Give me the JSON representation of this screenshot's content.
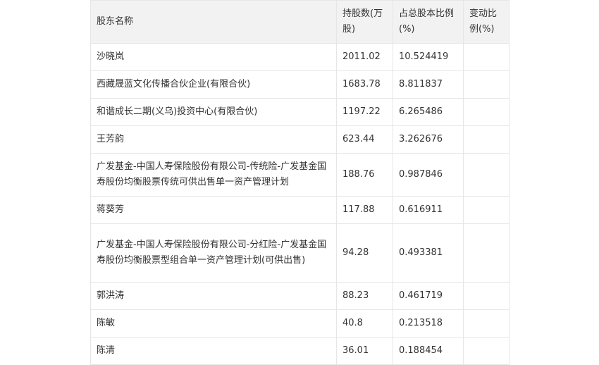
{
  "table": {
    "headers": [
      "股东名称",
      "持股数(万股)",
      "占总股本比例(%)",
      "变动比例(%)"
    ],
    "rows": [
      {
        "name": "沙晓岚",
        "shares": "2011.02",
        "ratio": "10.524419",
        "change": ""
      },
      {
        "name": "西藏晟蓝文化传播合伙企业(有限合伙)",
        "shares": "1683.78",
        "ratio": "8.811837",
        "change": ""
      },
      {
        "name": "和谐成长二期(义乌)投资中心(有限合伙)",
        "shares": "1197.22",
        "ratio": "6.265486",
        "change": ""
      },
      {
        "name": "王芳韵",
        "shares": "623.44",
        "ratio": "3.262676",
        "change": ""
      },
      {
        "name": "广发基金-中国人寿保险股份有限公司-传统险-广发基金国寿股份均衡股票传统可供出售单一资产管理计划",
        "shares": "188.76",
        "ratio": "0.987846",
        "change": ""
      },
      {
        "name": "蒋葵芳",
        "shares": "117.88",
        "ratio": "0.616911",
        "change": ""
      },
      {
        "name": "广发基金-中国人寿保险股份有限公司-分红险-广发基金国寿股份均衡股票型组合单一资产管理计划(可供出售)",
        "shares": "94.28",
        "ratio": "0.493381",
        "change": ""
      },
      {
        "name": "郭洪涛",
        "shares": "88.23",
        "ratio": "0.461719",
        "change": ""
      },
      {
        "name": "陈敏",
        "shares": "40.8",
        "ratio": "0.213518",
        "change": ""
      },
      {
        "name": "陈清",
        "shares": "36.01",
        "ratio": "0.188454",
        "change": ""
      }
    ]
  }
}
